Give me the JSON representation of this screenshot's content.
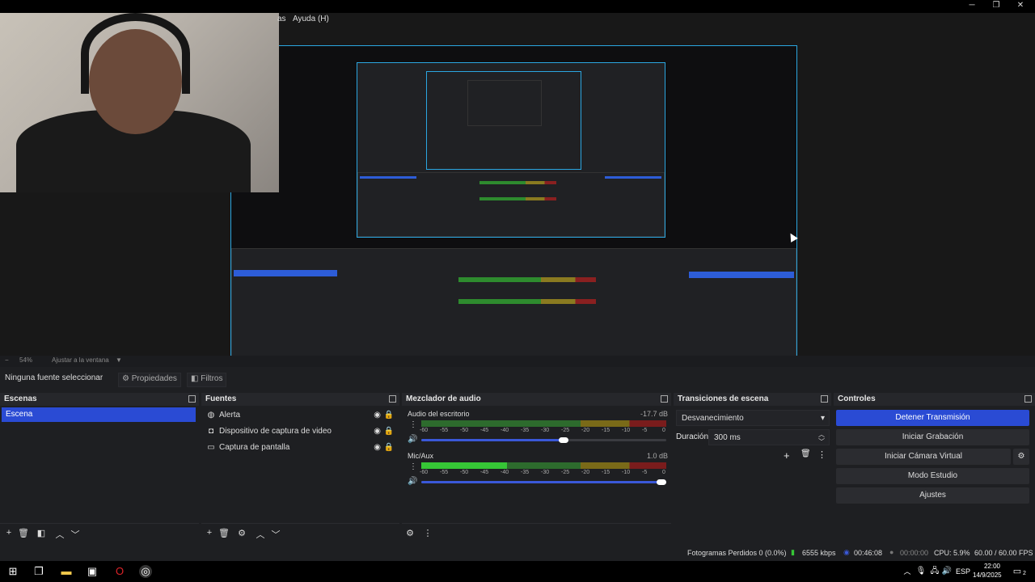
{
  "window": {
    "menu_partial": "as",
    "menu_help": "Ayuda (H)",
    "minimize": "─",
    "maximize": "❐",
    "close": "✕"
  },
  "zoom": {
    "minus": "−",
    "level": "54%",
    "fit": "Ajustar a la ventana"
  },
  "source_toolbar": {
    "no_source": "Ninguna fuente seleccionar",
    "properties": "Propiedades",
    "filters": "Filtros"
  },
  "scenes": {
    "title": "Escenas",
    "items": [
      "Escena"
    ]
  },
  "sources": {
    "title": "Fuentes",
    "items": [
      {
        "label": "Alerta",
        "icon": "globe-icon"
      },
      {
        "label": "Dispositivo de captura de video",
        "icon": "camera-icon"
      },
      {
        "label": "Captura de pantalla",
        "icon": "monitor-icon"
      }
    ]
  },
  "mixer": {
    "title": "Mezclador de audio",
    "ticks": [
      "-60",
      "-55",
      "-50",
      "-45",
      "-40",
      "-35",
      "-30",
      "-25",
      "-20",
      "-15",
      "-10",
      "-5",
      "0"
    ],
    "channels": [
      {
        "name": "Audio del escritorio",
        "db": "-17.7 dB",
        "level": 0.0,
        "volume": 0.6
      },
      {
        "name": "Mic/Aux",
        "db": "1.0 dB",
        "level": 0.35,
        "volume": 1.0
      }
    ]
  },
  "transitions": {
    "title": "Transiciones de escena",
    "selected": "Desvanecimiento",
    "duration_label": "Duración",
    "duration_value": "300 ms"
  },
  "controls": {
    "title": "Controles",
    "buttons": [
      "Detener Transmisión",
      "Iniciar Grabación",
      "Iniciar Cámara Virtual",
      "Modo Estudio",
      "Ajustes"
    ]
  },
  "status": {
    "dropped": "Fotogramas Perdidos 0 (0.0%)",
    "bitrate": "6555 kbps",
    "stream_time": "00:46:08",
    "rec_time": "00:00:00",
    "cpu": "CPU: 5.9%",
    "fps": "60.00 / 60.00 FPS"
  },
  "taskbar": {
    "lang": "ESP",
    "time": "22:00",
    "date": "14/9/2025",
    "notif": "2"
  },
  "colors": {
    "accent": "#2a4bd4",
    "preview_border": "#2ba6e0"
  }
}
